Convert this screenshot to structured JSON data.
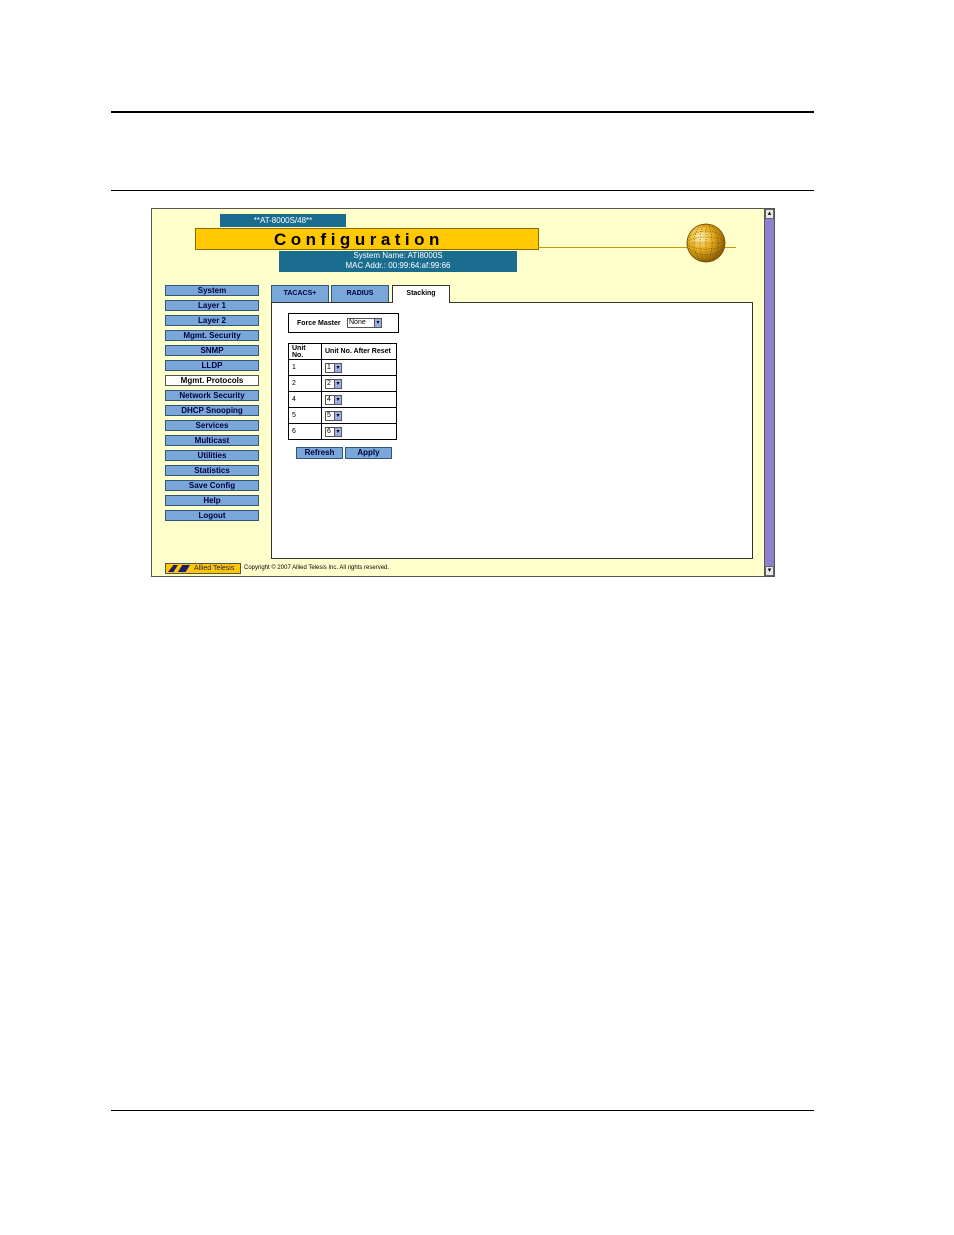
{
  "header": {
    "model": "**AT-8000S/48**",
    "title": "Configuration",
    "system_name": "System Name: ATI8000S",
    "mac_addr": "MAC Addr.: 00:99:64:af:99:66"
  },
  "menu": {
    "items": [
      {
        "label": "System"
      },
      {
        "label": "Layer 1"
      },
      {
        "label": "Layer 2"
      },
      {
        "label": "Mgmt. Security"
      },
      {
        "label": "SNMP"
      },
      {
        "label": "LLDP"
      },
      {
        "label": "Mgmt. Protocols",
        "active": true
      },
      {
        "label": "Network Security"
      },
      {
        "label": "DHCP Snooping"
      },
      {
        "label": "Services"
      },
      {
        "label": "Multicast"
      },
      {
        "label": "Utilities"
      },
      {
        "label": "Statistics"
      },
      {
        "label": "Save Config"
      },
      {
        "label": "Help"
      },
      {
        "label": "Logout"
      }
    ]
  },
  "tabs": [
    {
      "label": "TACACS+"
    },
    {
      "label": "RADIUS"
    },
    {
      "label": "Stacking",
      "active": true
    }
  ],
  "stacking": {
    "force_master_label": "Force Master",
    "force_master_value": "None",
    "table_headers": [
      "Unit No.",
      "Unit No. After Reset"
    ],
    "rows": [
      {
        "unit": "1",
        "after_reset": "1"
      },
      {
        "unit": "2",
        "after_reset": "2"
      },
      {
        "unit": "4",
        "after_reset": "4"
      },
      {
        "unit": "5",
        "after_reset": "5"
      },
      {
        "unit": "6",
        "after_reset": "6"
      }
    ],
    "refresh_label": "Refresh",
    "apply_label": "Apply"
  },
  "footer": {
    "logo_text": "Allied Telesis",
    "copyright": "Copyright © 2007 Allied Telesis Inc. All rights reserved."
  },
  "colors": {
    "page_bg": "#ffffcc",
    "accent_yellow": "#ffc800",
    "header_blue": "#1a6d8f",
    "menu_blue": "#7aa7da"
  }
}
